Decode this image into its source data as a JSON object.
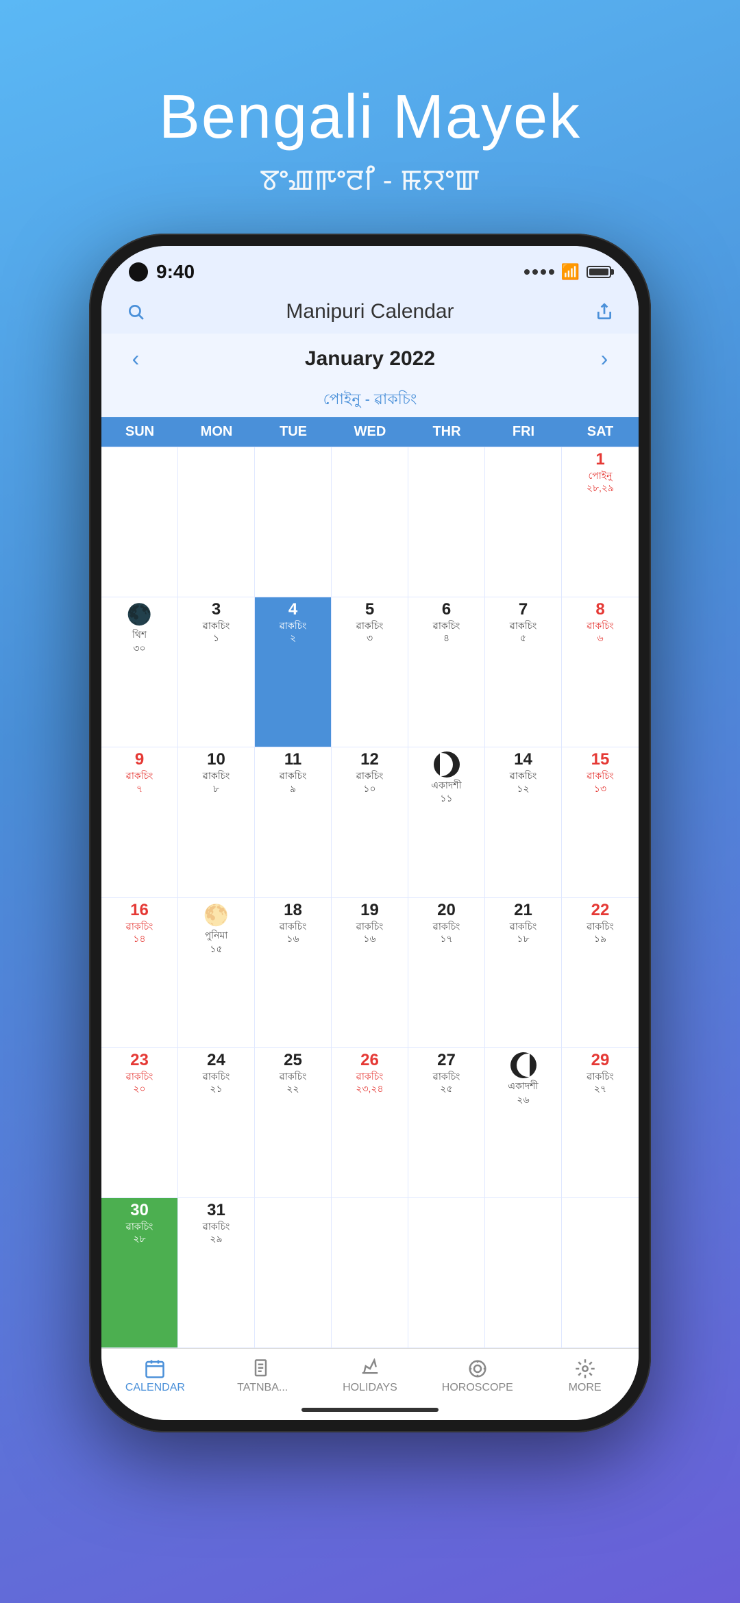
{
  "header": {
    "title": "Bengali Mayek",
    "subtitle": "ꯕꯦꯉꯒꯦꯂꯤ - ꯃꯌꯦꯛ"
  },
  "statusBar": {
    "time": "9:40",
    "signal": "····",
    "wifi": "wifi",
    "battery": "full"
  },
  "navBar": {
    "title": "Manipuri Calendar",
    "searchIcon": "🔍",
    "shareIcon": "⬆"
  },
  "calendar": {
    "monthTitle": "January 2022",
    "monthSubtitle": "পোইনু - ৱাকচিং",
    "prevBtn": "‹",
    "nextBtn": "›",
    "dayHeaders": [
      "SUN",
      "MON",
      "TUE",
      "WED",
      "THR",
      "FRI",
      "SAT"
    ]
  },
  "tabBar": {
    "items": [
      {
        "label": "CALENDAR",
        "icon": "📅",
        "active": true
      },
      {
        "label": "TATNBA...",
        "icon": "📖",
        "active": false
      },
      {
        "label": "HOLIDAYS",
        "icon": "✈",
        "active": false
      },
      {
        "label": "HOROSCOPE",
        "icon": "⚙",
        "active": false
      },
      {
        "label": "MORE",
        "icon": "⚙",
        "active": false
      }
    ]
  }
}
